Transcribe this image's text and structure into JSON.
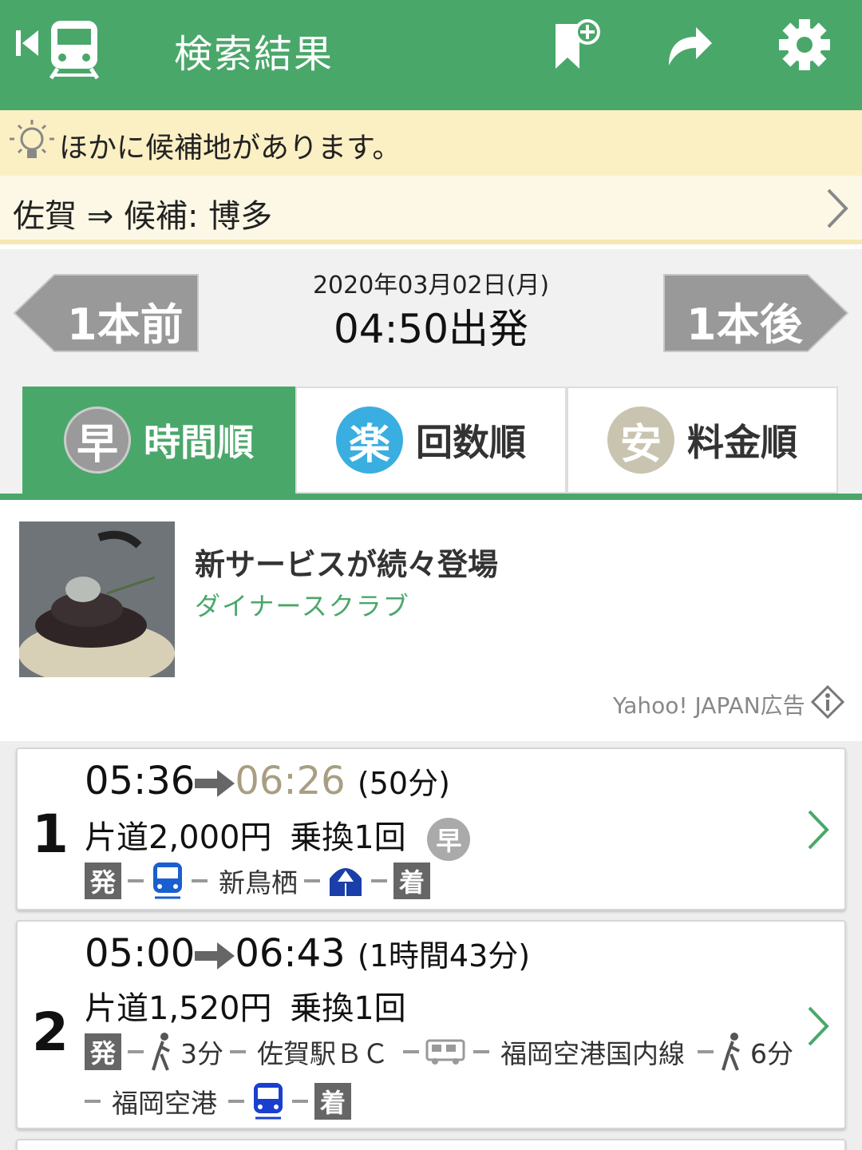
{
  "header": {
    "title": "検索結果",
    "bg_color": "#4aa76a"
  },
  "notice": {
    "text": "ほかに候補地があります。",
    "candidate": "佐賀 ⇒ 候補: 博多"
  },
  "timenav": {
    "date": "2020年03月02日(月)",
    "time": "04:50出発",
    "prev_label": "1本前",
    "next_label": "1本後"
  },
  "tabs": [
    {
      "badge": "早",
      "label": "時間順",
      "active": true,
      "badge_color": "#9a9a9a"
    },
    {
      "badge": "楽",
      "label": "回数順",
      "active": false,
      "badge_color": "#3aaee0"
    },
    {
      "badge": "安",
      "label": "料金順",
      "active": false,
      "badge_color": "#c9c4b0"
    }
  ],
  "ad": {
    "title": "新サービスが続々登場",
    "subtitle": "ダイナースクラブ",
    "label": "Yahoo! JAPAN広告"
  },
  "routes": [
    {
      "rank": "1",
      "depart": "05:36",
      "arrive": "06:26",
      "duration": "(50分)",
      "fare": "片道2,000円",
      "transfers": "乗換1回",
      "badge": "早",
      "dep_tag": "発",
      "arr_tag": "着",
      "via": "新鳥栖"
    },
    {
      "rank": "2",
      "depart": "05:00",
      "arrive": "06:43",
      "duration": "(1時間43分)",
      "fare": "片道1,520円",
      "transfers": "乗換1回",
      "dep_tag": "発",
      "arr_tag": "着",
      "walk1": "3分",
      "stop1": "佐賀駅ＢＣ",
      "bus_line": "福岡空港国内線",
      "walk2": "6分",
      "stop2": "福岡空港"
    }
  ]
}
